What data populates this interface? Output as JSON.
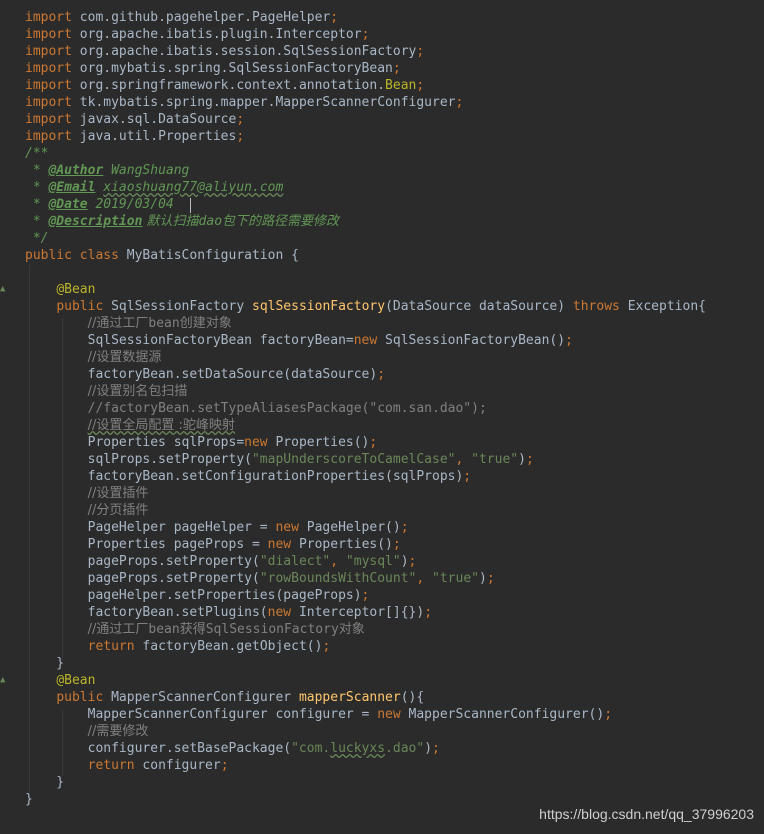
{
  "watermark": "https://blog.csdn.net/qq_37996203",
  "lines": [
    [
      {
        "t": "import ",
        "c": "kw"
      },
      {
        "t": "com.github.pagehelper.PageHelper",
        "c": ""
      },
      {
        "t": ";",
        "c": "kw"
      }
    ],
    [
      {
        "t": "import ",
        "c": "kw"
      },
      {
        "t": "org.apache.ibatis.plugin.Interceptor",
        "c": ""
      },
      {
        "t": ";",
        "c": "kw"
      }
    ],
    [
      {
        "t": "import ",
        "c": "kw"
      },
      {
        "t": "org.apache.ibatis.session.SqlSessionFactory",
        "c": ""
      },
      {
        "t": ";",
        "c": "kw"
      }
    ],
    [
      {
        "t": "import ",
        "c": "kw"
      },
      {
        "t": "org.mybatis.spring.SqlSessionFactoryBean",
        "c": ""
      },
      {
        "t": ";",
        "c": "kw"
      }
    ],
    [
      {
        "t": "import ",
        "c": "kw"
      },
      {
        "t": "org.springframework.context.annotation.",
        "c": ""
      },
      {
        "t": "Bean",
        "c": "ann"
      },
      {
        "t": ";",
        "c": "kw"
      }
    ],
    [
      {
        "t": "import ",
        "c": "kw"
      },
      {
        "t": "tk.mybatis.spring.mapper.MapperScannerConfigurer",
        "c": ""
      },
      {
        "t": ";",
        "c": "kw"
      }
    ],
    [
      {
        "t": "import ",
        "c": "kw"
      },
      {
        "t": "javax.sql.DataSource",
        "c": ""
      },
      {
        "t": ";",
        "c": "kw"
      }
    ],
    [
      {
        "t": "import ",
        "c": "kw"
      },
      {
        "t": "java.util.Properties",
        "c": ""
      },
      {
        "t": ";",
        "c": "kw"
      }
    ],
    [
      {
        "t": "/**",
        "c": "doc"
      }
    ],
    [
      {
        "t": " * ",
        "c": "doc"
      },
      {
        "t": "@Author",
        "c": "doctag"
      },
      {
        "t": " WangShuang",
        "c": "doc"
      }
    ],
    [
      {
        "t": " * ",
        "c": "doc"
      },
      {
        "t": "@Email",
        "c": "doctag"
      },
      {
        "t": " ",
        "c": "doc"
      },
      {
        "t": "xiaoshuang77@aliyun.com",
        "c": "doc squig"
      }
    ],
    [
      {
        "t": " * ",
        "c": "doc"
      },
      {
        "t": "@Date",
        "c": "doctag"
      },
      {
        "t": " 2019/03/04",
        "c": "doc"
      }
    ],
    [
      {
        "t": " * ",
        "c": "doc"
      },
      {
        "t": "@Description",
        "c": "doctag"
      },
      {
        "t": " 默认扫描",
        "c": "doc zh"
      },
      {
        "t": "dao",
        "c": "doc"
      },
      {
        "t": "包下的路径需要修改",
        "c": "doc zh"
      }
    ],
    [
      {
        "t": " */",
        "c": "doc"
      }
    ],
    [
      {
        "t": "public class ",
        "c": "kw"
      },
      {
        "t": "MyBatisConfiguration {",
        "c": ""
      }
    ],
    [],
    [
      {
        "t": "    ",
        "c": ""
      },
      {
        "t": "@Bean",
        "c": "ann"
      }
    ],
    [
      {
        "t": "    ",
        "c": ""
      },
      {
        "t": "public ",
        "c": "kw"
      },
      {
        "t": "SqlSessionFactory ",
        "c": ""
      },
      {
        "t": "sqlSessionFactory",
        "c": "fn"
      },
      {
        "t": "(DataSource dataSource) ",
        "c": ""
      },
      {
        "t": "throws ",
        "c": "kw"
      },
      {
        "t": "Exception{",
        "c": ""
      }
    ],
    [
      {
        "t": "        ",
        "c": ""
      },
      {
        "t": "//通过工厂",
        "c": "cmt zh"
      },
      {
        "t": "bean",
        "c": "cmt"
      },
      {
        "t": "创建对象",
        "c": "cmt zh"
      }
    ],
    [
      {
        "t": "        SqlSessionFactoryBean factoryBean=",
        "c": ""
      },
      {
        "t": "new ",
        "c": "kw"
      },
      {
        "t": "SqlSessionFactoryBean()",
        "c": ""
      },
      {
        "t": ";",
        "c": "kw"
      }
    ],
    [
      {
        "t": "        ",
        "c": ""
      },
      {
        "t": "//设置数据源",
        "c": "cmt zh"
      }
    ],
    [
      {
        "t": "        factoryBean.setDataSource(dataSource)",
        "c": ""
      },
      {
        "t": ";",
        "c": "kw"
      }
    ],
    [
      {
        "t": "        ",
        "c": ""
      },
      {
        "t": "//设置别名包扫描",
        "c": "cmt zh"
      }
    ],
    [
      {
        "t": "        ",
        "c": ""
      },
      {
        "t": "//factoryBean.setTypeAliasesPackage(\"com.san.dao\");",
        "c": "cmt"
      }
    ],
    [
      {
        "t": "        ",
        "c": ""
      },
      {
        "t": "//设置全局配置 :驼峰映射",
        "c": "cmt zh squig"
      }
    ],
    [
      {
        "t": "        Properties sqlProps=",
        "c": ""
      },
      {
        "t": "new ",
        "c": "kw"
      },
      {
        "t": "Properties()",
        "c": ""
      },
      {
        "t": ";",
        "c": "kw"
      }
    ],
    [
      {
        "t": "        sqlProps.setProperty(",
        "c": ""
      },
      {
        "t": "\"mapUnderscoreToCamelCase\"",
        "c": "str"
      },
      {
        "t": ", ",
        "c": "kw"
      },
      {
        "t": "\"true\"",
        "c": "str"
      },
      {
        "t": ")",
        "c": ""
      },
      {
        "t": ";",
        "c": "kw"
      }
    ],
    [
      {
        "t": "        factoryBean.setConfigurationProperties(sqlProps)",
        "c": ""
      },
      {
        "t": ";",
        "c": "kw"
      }
    ],
    [
      {
        "t": "        ",
        "c": ""
      },
      {
        "t": "//设置插件",
        "c": "cmt zh"
      }
    ],
    [
      {
        "t": "        ",
        "c": ""
      },
      {
        "t": "//分页插件",
        "c": "cmt zh"
      }
    ],
    [
      {
        "t": "        PageHelper pageHelper = ",
        "c": ""
      },
      {
        "t": "new ",
        "c": "kw"
      },
      {
        "t": "PageHelper()",
        "c": ""
      },
      {
        "t": ";",
        "c": "kw"
      }
    ],
    [
      {
        "t": "        Properties pageProps = ",
        "c": ""
      },
      {
        "t": "new ",
        "c": "kw"
      },
      {
        "t": "Properties()",
        "c": ""
      },
      {
        "t": ";",
        "c": "kw"
      }
    ],
    [
      {
        "t": "        pageProps.setProperty(",
        "c": ""
      },
      {
        "t": "\"dialect\"",
        "c": "str"
      },
      {
        "t": ", ",
        "c": "kw"
      },
      {
        "t": "\"mysql\"",
        "c": "str"
      },
      {
        "t": ")",
        "c": ""
      },
      {
        "t": ";",
        "c": "kw"
      }
    ],
    [
      {
        "t": "        pageProps.setProperty(",
        "c": ""
      },
      {
        "t": "\"rowBoundsWithCount\"",
        "c": "str"
      },
      {
        "t": ", ",
        "c": "kw"
      },
      {
        "t": "\"true\"",
        "c": "str"
      },
      {
        "t": ")",
        "c": ""
      },
      {
        "t": ";",
        "c": "kw"
      }
    ],
    [
      {
        "t": "        pageHelper.setProperties(pageProps)",
        "c": ""
      },
      {
        "t": ";",
        "c": "kw"
      }
    ],
    [
      {
        "t": "        factoryBean.setPlugins(",
        "c": ""
      },
      {
        "t": "new ",
        "c": "kw"
      },
      {
        "t": "Interceptor[]{})",
        "c": ""
      },
      {
        "t": ";",
        "c": "kw"
      }
    ],
    [
      {
        "t": "        ",
        "c": ""
      },
      {
        "t": "//通过工厂",
        "c": "cmt zh"
      },
      {
        "t": "bean",
        "c": "cmt"
      },
      {
        "t": "获得",
        "c": "cmt zh"
      },
      {
        "t": "SqlSessionFactory",
        "c": "cmt"
      },
      {
        "t": "对象",
        "c": "cmt zh"
      }
    ],
    [
      {
        "t": "        ",
        "c": ""
      },
      {
        "t": "return ",
        "c": "kw"
      },
      {
        "t": "factoryBean.getObject()",
        "c": ""
      },
      {
        "t": ";",
        "c": "kw"
      }
    ],
    [
      {
        "t": "    }",
        "c": ""
      }
    ],
    [
      {
        "t": "    ",
        "c": ""
      },
      {
        "t": "@Bean",
        "c": "ann"
      }
    ],
    [
      {
        "t": "    ",
        "c": ""
      },
      {
        "t": "public ",
        "c": "kw"
      },
      {
        "t": "MapperScannerConfigurer ",
        "c": ""
      },
      {
        "t": "mapperScanner",
        "c": "fn"
      },
      {
        "t": "(){",
        "c": ""
      }
    ],
    [
      {
        "t": "        MapperScannerConfigurer configurer = ",
        "c": ""
      },
      {
        "t": "new ",
        "c": "kw"
      },
      {
        "t": "MapperScannerConfigurer()",
        "c": ""
      },
      {
        "t": ";",
        "c": "kw"
      }
    ],
    [
      {
        "t": "        ",
        "c": ""
      },
      {
        "t": "//需要修改",
        "c": "cmt zh"
      }
    ],
    [
      {
        "t": "        configurer.setBasePackage(",
        "c": ""
      },
      {
        "t": "\"com.",
        "c": "str"
      },
      {
        "t": "luckyxs",
        "c": "str squig"
      },
      {
        "t": ".dao\"",
        "c": "str"
      },
      {
        "t": ")",
        "c": ""
      },
      {
        "t": ";",
        "c": "kw"
      }
    ],
    [
      {
        "t": "        ",
        "c": ""
      },
      {
        "t": "return ",
        "c": "kw"
      },
      {
        "t": "configurer",
        "c": ""
      },
      {
        "t": ";",
        "c": "kw"
      }
    ],
    [
      {
        "t": "    }",
        "c": ""
      }
    ],
    [
      {
        "t": "}",
        "c": ""
      }
    ]
  ]
}
